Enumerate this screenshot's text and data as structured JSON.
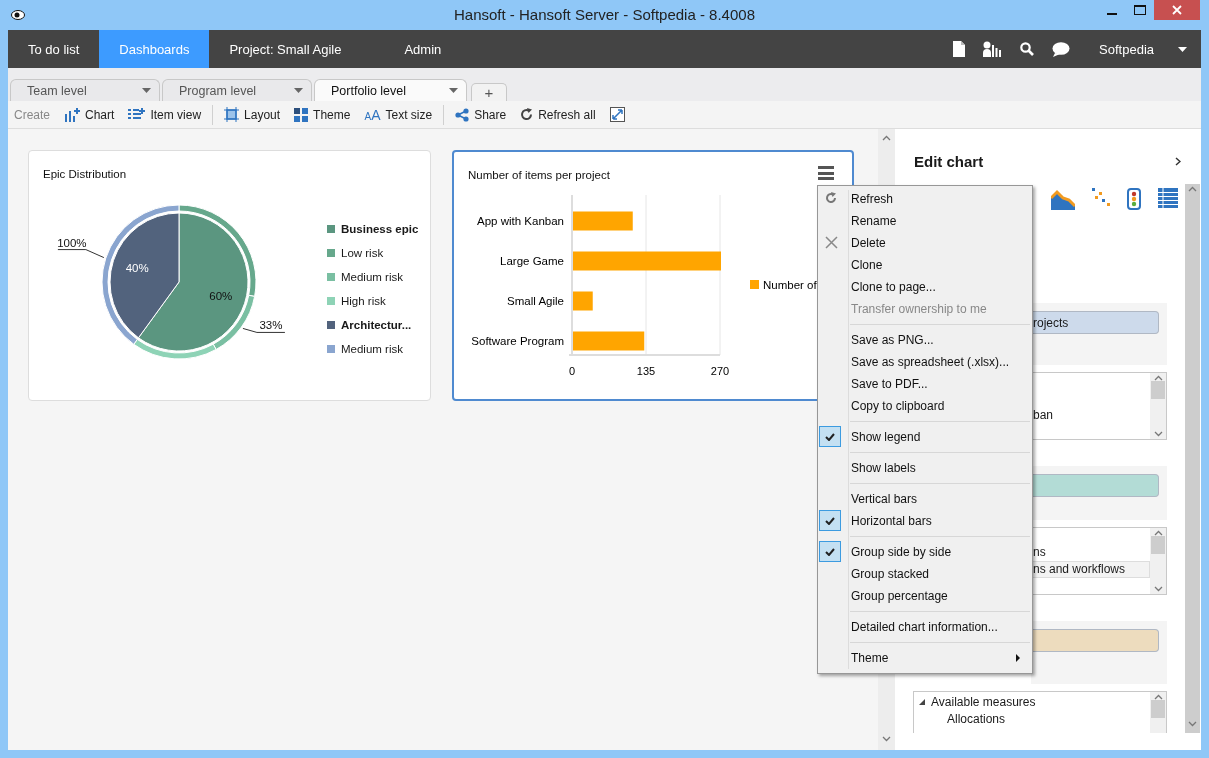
{
  "window": {
    "title": "Hansoft - Hansoft Server - Softpedia - 8.4008"
  },
  "nav": {
    "items": [
      {
        "label": "To do list",
        "selected": false
      },
      {
        "label": "Dashboards",
        "selected": true
      },
      {
        "label": "Project: Small Agile",
        "selected": false
      },
      {
        "label": "Admin",
        "selected": false
      }
    ],
    "user": "Softpedia"
  },
  "tabs": [
    {
      "label": "Team level",
      "selected": false
    },
    {
      "label": "Program level",
      "selected": false
    },
    {
      "label": "Portfolio level",
      "selected": true
    }
  ],
  "add_tab": "+",
  "toolbar": [
    {
      "kind": "label",
      "label": "Create"
    },
    {
      "kind": "chart",
      "label": "Chart"
    },
    {
      "kind": "itemview",
      "label": "Item view"
    },
    {
      "kind": "separator"
    },
    {
      "kind": "layout",
      "label": "Layout"
    },
    {
      "kind": "theme",
      "label": "Theme"
    },
    {
      "kind": "textsize",
      "label": "Text size",
      "glyph": "AA"
    },
    {
      "kind": "separator"
    },
    {
      "kind": "share",
      "label": "Share"
    },
    {
      "kind": "refresh",
      "label": "Refresh all"
    },
    {
      "kind": "fullscreen"
    }
  ],
  "epic_card": {
    "title": "Epic Distribution",
    "chart_data": {
      "type": "donut",
      "series": [
        {
          "values": [
            60,
            40
          ],
          "colors": [
            "#5b9680",
            "#52637d"
          ],
          "value_labels": [
            "60%",
            "40%"
          ]
        },
        {
          "values": [
            28,
            14,
            18,
            40
          ],
          "colors": [
            "#66a88c",
            "#7abfa2",
            "#8ed3b6",
            "#8aa5cf"
          ]
        }
      ]
    },
    "ring_labels": [
      "33%",
      "100%"
    ],
    "legend": [
      {
        "label": "Business epic",
        "kind": "group",
        "color": "#5b9680"
      },
      {
        "label": "Low risk",
        "kind": "risk",
        "color": "#66a88c"
      },
      {
        "label": "Medium risk",
        "kind": "risk",
        "color": "#7abfa2"
      },
      {
        "label": "High risk",
        "kind": "risk",
        "color": "#8ed3b6"
      },
      {
        "label": "Architectur...",
        "kind": "group",
        "color": "#52637d"
      },
      {
        "label": "Medium risk",
        "kind": "risk",
        "color": "#8aa5cf"
      }
    ]
  },
  "items_card": {
    "title": "Number of items per project",
    "selected": true,
    "chart_data": {
      "type": "bar",
      "orientation": "horizontal",
      "categories": [
        "App with Kanban",
        "Large Game",
        "Small Agile",
        "Software Program"
      ],
      "series": [
        {
          "name": "Number of",
          "color": "#ffa500",
          "values": [
            109,
            270,
            36,
            130
          ]
        }
      ],
      "xlim": [
        0,
        270
      ],
      "xticks": [
        0,
        135,
        270
      ]
    }
  },
  "context_menu": {
    "groups": [
      [
        {
          "label": "Refresh",
          "checked": false,
          "disabled": false
        },
        {
          "label": "Rename",
          "checked": false,
          "disabled": false
        },
        {
          "label": "Delete",
          "checked": false,
          "disabled": false
        },
        {
          "label": "Clone",
          "checked": false,
          "disabled": false
        },
        {
          "label": "Clone to page...",
          "checked": false,
          "disabled": false
        },
        {
          "label": "Transfer ownership to me",
          "checked": false,
          "disabled": true
        }
      ],
      [
        {
          "label": "Save as PNG...",
          "checked": false,
          "disabled": false
        },
        {
          "label": "Save as spreadsheet (.xlsx)...",
          "checked": false,
          "disabled": false
        },
        {
          "label": "Save to PDF...",
          "checked": false,
          "disabled": false
        },
        {
          "label": "Copy to clipboard",
          "checked": false,
          "disabled": false
        }
      ],
      [
        {
          "label": "Show legend",
          "checked": true,
          "disabled": false
        }
      ],
      [
        {
          "label": "Show labels",
          "checked": false,
          "disabled": false
        }
      ],
      [
        {
          "label": "Vertical bars",
          "checked": false,
          "disabled": false
        },
        {
          "label": "Horizontal bars",
          "checked": true,
          "disabled": false
        }
      ],
      [
        {
          "label": "Group side by side",
          "checked": true,
          "disabled": false
        },
        {
          "label": "Group stacked",
          "checked": false,
          "disabled": false
        },
        {
          "label": "Group percentage",
          "checked": false,
          "disabled": false
        }
      ],
      [
        {
          "label": "Detailed chart information...",
          "checked": false,
          "disabled": false
        }
      ],
      [
        {
          "label": "Theme",
          "submenu": true,
          "checked": false,
          "disabled": false
        }
      ]
    ]
  },
  "edit_panel": {
    "title": "Edit chart",
    "sections": [
      {
        "color": "#cddaeb",
        "pill": "rojects",
        "list": [
          {
            "label": "ban",
            "selected": false
          }
        ]
      },
      {
        "color": "#b3dcd6",
        "list": [
          {
            "label": "ns",
            "selected": false
          },
          {
            "label": "ns and workflows",
            "selected": true
          }
        ]
      },
      {
        "color": "#eddcbe"
      }
    ],
    "tree": [
      {
        "label": "Available measures",
        "expanded": true,
        "children": [
          {
            "label": "Allocations"
          }
        ]
      }
    ]
  }
}
